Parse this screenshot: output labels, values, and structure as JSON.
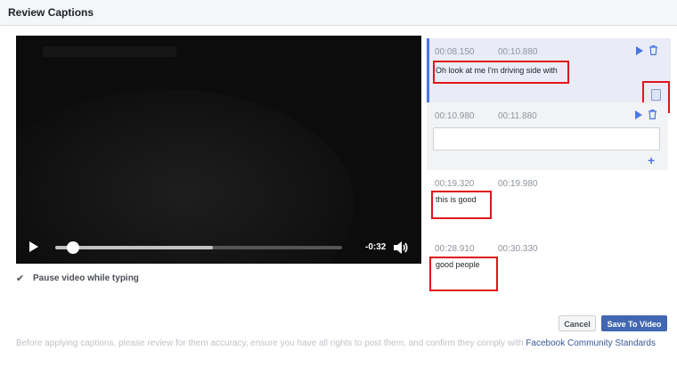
{
  "header": {
    "title": "Review Captions"
  },
  "player": {
    "time_remaining": "-0:32",
    "progress": 0.06,
    "buffered": 0.55,
    "icons": {
      "play": "play-icon",
      "volume": "volume-icon"
    }
  },
  "pause_option": {
    "label": "Pause video while typing",
    "checked": true
  },
  "captions": [
    {
      "start": "00:08.150",
      "end": "00:10.880",
      "text": "Oh look at me I'm driving side with"
    },
    {
      "start": "00:10.980",
      "end": "00:11.880",
      "text": ""
    },
    {
      "start": "00:19.320",
      "end": "00:19.980",
      "text": "this is good"
    },
    {
      "start": "00:28.910",
      "end": "00:30.330",
      "text": "good people"
    }
  ],
  "buttons": {
    "cancel": "Cancel",
    "save": "Save To Video"
  },
  "footer": {
    "text": "Before applying captions, please review for them accuracy, ensure you have all rights to post them, and confirm they comply with",
    "link": "Facebook Community Standards"
  },
  "colors": {
    "accent": "#4267b2",
    "highlight": "#e0151c",
    "active_row": "#e9ecf6"
  }
}
